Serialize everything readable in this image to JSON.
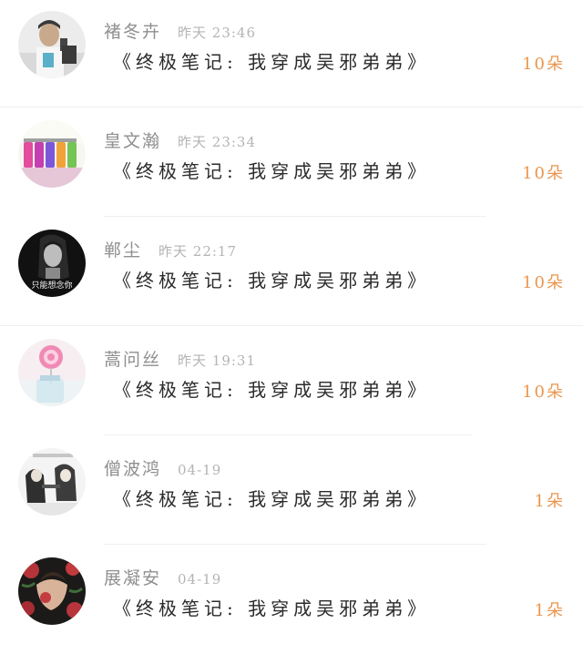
{
  "colors": {
    "count": "#e9964e",
    "name": "#8f8f8f",
    "time": "#b4b4b4",
    "message": "#2b2b2b",
    "divider": "#efefef"
  },
  "gift_list": {
    "rows": [
      {
        "name": "褚冬卉",
        "time": "昨天 23:46",
        "message": "《终极笔记: 我穿成吴邪弟弟》",
        "count": "10朵",
        "avatar": "avatar-boy-selfie"
      },
      {
        "name": "皇文瀚",
        "time": "昨天 23:34",
        "message": "《终极笔记: 我穿成吴邪弟弟》",
        "count": "10朵",
        "avatar": "avatar-color-bottles"
      },
      {
        "name": "郸尘",
        "time": "昨天 22:17",
        "message": "《终极笔记: 我穿成吴邪弟弟》",
        "count": "10朵",
        "avatar": "avatar-dark-girl",
        "avatar_caption": "只能想念你"
      },
      {
        "name": "蒿问丝",
        "time": "昨天 19:31",
        "message": "《终极笔记: 我穿成吴邪弟弟》",
        "count": "10朵",
        "avatar": "avatar-lollipop"
      },
      {
        "name": "僧波鸿",
        "time": "04-19",
        "message": "《终极笔记: 我穿成吴邪弟弟》",
        "count": "1朵",
        "avatar": "avatar-anime-sketch"
      },
      {
        "name": "展凝安",
        "time": "04-19",
        "message": "《终极笔记: 我穿成吴邪弟弟》",
        "count": "1朵",
        "avatar": "avatar-roses"
      }
    ]
  }
}
